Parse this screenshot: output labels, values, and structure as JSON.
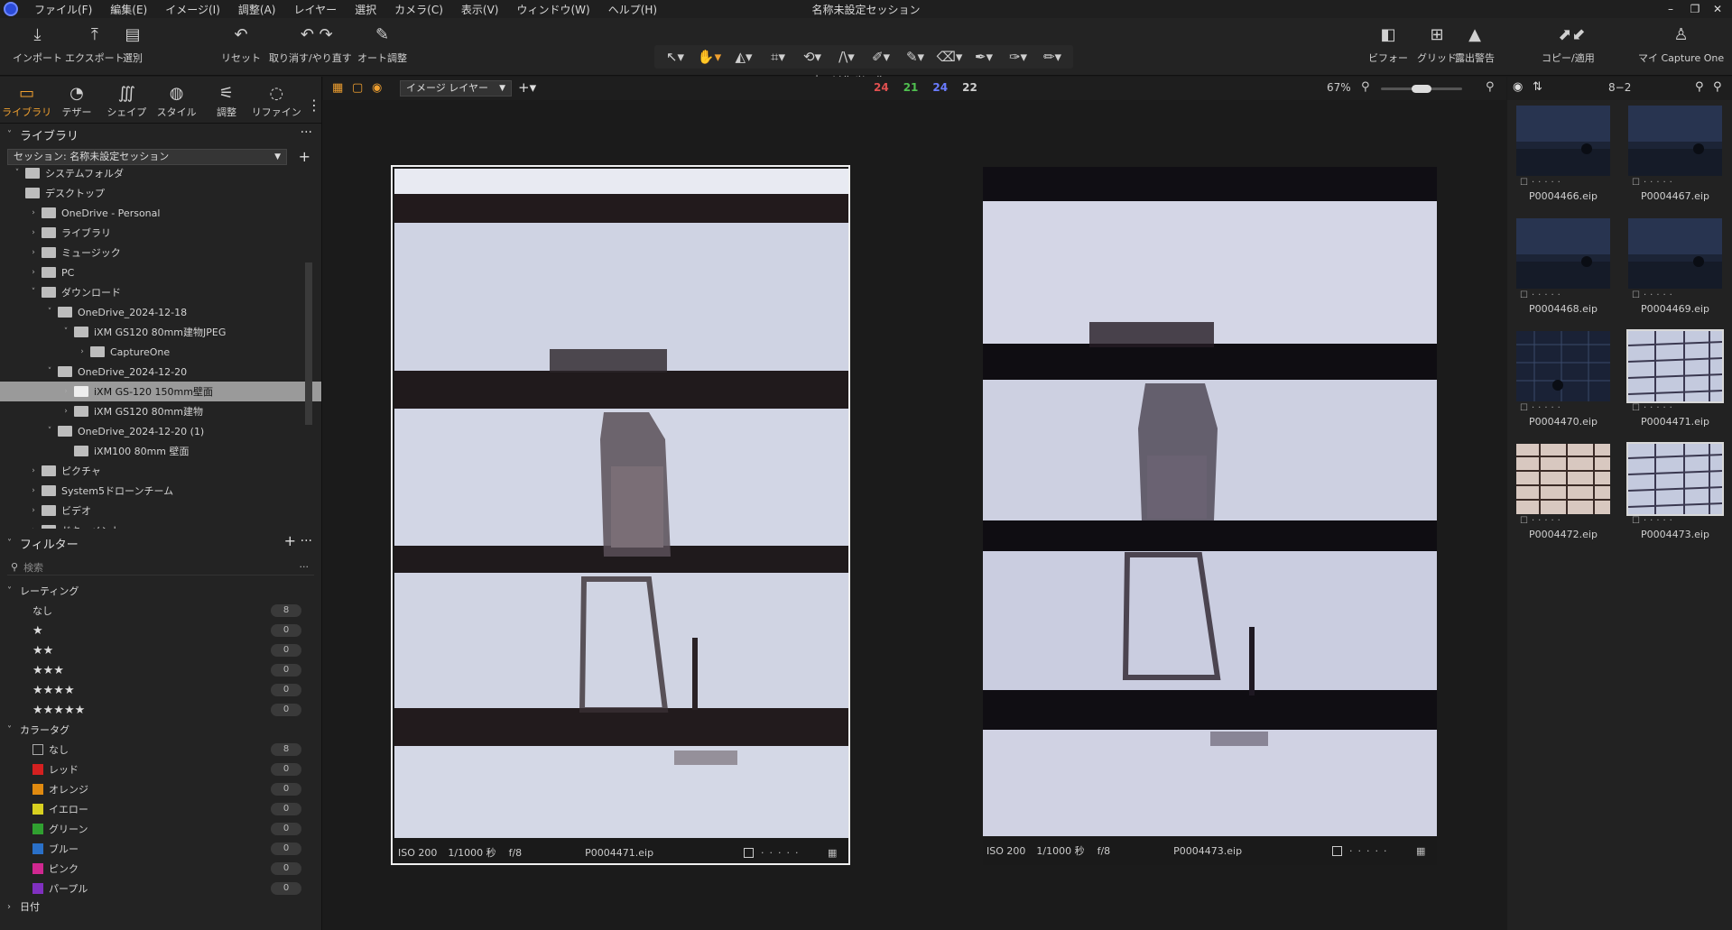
{
  "menu": {
    "items": [
      "ファイル(F)",
      "編集(E)",
      "イメージ(I)",
      "調整(A)",
      "レイヤー",
      "選択",
      "カメラ(C)",
      "表示(V)",
      "ウィンドウ(W)",
      "ヘルプ(H)"
    ],
    "title": "名称未設定セッション"
  },
  "toolbar": {
    "left": [
      {
        "label": "インポート",
        "icon": "import-icon"
      },
      {
        "label": "エクスポート",
        "icon": "export-icon"
      },
      {
        "label": "選別",
        "icon": "cull-icon"
      },
      {
        "label": "リセット",
        "icon": "reset-icon"
      },
      {
        "label": "取り消す/やり直す",
        "icon": "undo-redo-icon"
      },
      {
        "label": "オート調整",
        "icon": "auto-adjust-icon"
      }
    ],
    "cursor_label": "カーソル ツール",
    "right": [
      {
        "label": "ビフォー",
        "icon": "before-icon"
      },
      {
        "label": "グリッド",
        "icon": "grid-icon"
      },
      {
        "label": "露出警告",
        "icon": "exposure-warning-icon"
      },
      {
        "label": "コピー/適用",
        "icon": "copy-apply-icon"
      },
      {
        "label": "マイ Capture One",
        "icon": "user-icon"
      }
    ]
  },
  "tooltabs": [
    {
      "label": "ライブラリ",
      "active": true
    },
    {
      "label": "テザー"
    },
    {
      "label": "シェイプ"
    },
    {
      "label": "スタイル"
    },
    {
      "label": "調整"
    },
    {
      "label": "リファイン"
    }
  ],
  "library": {
    "title": "ライブラリ",
    "session": "セッション: 名称未設定セッション",
    "tree": [
      {
        "label": "システムフォルダ",
        "level": 0,
        "twisty": "˅"
      },
      {
        "label": "デスクトップ",
        "level": 0,
        "twisty": ""
      },
      {
        "label": "OneDrive - Personal",
        "level": 1,
        "twisty": "›"
      },
      {
        "label": "ライブラリ",
        "level": 1,
        "twisty": "›"
      },
      {
        "label": "ミュージック",
        "level": 1,
        "twisty": "›"
      },
      {
        "label": "PC",
        "level": 1,
        "twisty": "›"
      },
      {
        "label": "ダウンロード",
        "level": 1,
        "twisty": "˅"
      },
      {
        "label": "OneDrive_2024-12-18",
        "level": 2,
        "twisty": "˅"
      },
      {
        "label": "iXM GS120 80mm建物JPEG",
        "level": 3,
        "twisty": "˅"
      },
      {
        "label": "CaptureOne",
        "level": 4,
        "twisty": "›"
      },
      {
        "label": "OneDrive_2024-12-20",
        "level": 2,
        "twisty": "˅"
      },
      {
        "label": "iXM GS-120 150mm壁面",
        "level": 3,
        "twisty": "›",
        "selected": true
      },
      {
        "label": "iXM GS120 80mm建物",
        "level": 3,
        "twisty": "›"
      },
      {
        "label": "OneDrive_2024-12-20 (1)",
        "level": 2,
        "twisty": "˅"
      },
      {
        "label": "iXM100 80mm 壁面",
        "level": 3,
        "twisty": ""
      },
      {
        "label": "ピクチャ",
        "level": 1,
        "twisty": "›"
      },
      {
        "label": "System5ドローンチーム",
        "level": 1,
        "twisty": "›"
      },
      {
        "label": "ビデオ",
        "level": 1,
        "twisty": "›"
      },
      {
        "label": "ドキュメント",
        "level": 1,
        "twisty": "›"
      }
    ]
  },
  "filters": {
    "title": "フィルター",
    "search_placeholder": "検索",
    "rating_title": "レーティング",
    "ratings": [
      {
        "label": "なし",
        "count": "8"
      },
      {
        "stars": "★",
        "count": "0"
      },
      {
        "stars": "★★",
        "count": "0"
      },
      {
        "stars": "★★★",
        "count": "0"
      },
      {
        "stars": "★★★★",
        "count": "0"
      },
      {
        "stars": "★★★★★",
        "count": "0"
      }
    ],
    "colortag_title": "カラータグ",
    "colortags": [
      {
        "label": "なし",
        "color": "none",
        "count": "8"
      },
      {
        "label": "レッド",
        "color": "#d42020",
        "count": "0"
      },
      {
        "label": "オレンジ",
        "color": "#e08a10",
        "count": "0"
      },
      {
        "label": "イエロー",
        "color": "#d8d020",
        "count": "0"
      },
      {
        "label": "グリーン",
        "color": "#30a030",
        "count": "0"
      },
      {
        "label": "ブルー",
        "color": "#2a70c8",
        "count": "0"
      },
      {
        "label": "ピンク",
        "color": "#d02890",
        "count": "0"
      },
      {
        "label": "パープル",
        "color": "#8030c0",
        "count": "0"
      }
    ],
    "date_title": "日付"
  },
  "viewer": {
    "layer_select": "イメージ レイヤー",
    "counts": [
      {
        "value": "24",
        "color": "#e05050"
      },
      {
        "value": "21",
        "color": "#50c050"
      },
      {
        "value": "24",
        "color": "#6a7cff"
      },
      {
        "value": "22",
        "color": "#cfcfcf"
      }
    ],
    "zoom": "67%",
    "photos": [
      {
        "iso": "ISO 200",
        "shutter": "1/1000 秒",
        "aperture": "f/8",
        "file": "P0004471.eip"
      },
      {
        "iso": "ISO 200",
        "shutter": "1/1000 秒",
        "aperture": "f/8",
        "file": "P0004473.eip"
      }
    ]
  },
  "browser": {
    "count": "8−2",
    "thumbs": [
      {
        "file": "P0004466.eip",
        "kind": "dark"
      },
      {
        "file": "P0004467.eip",
        "kind": "dark"
      },
      {
        "file": "P0004468.eip",
        "kind": "dark"
      },
      {
        "file": "P0004469.eip",
        "kind": "dark"
      },
      {
        "file": "P0004470.eip",
        "kind": "grid"
      },
      {
        "file": "P0004471.eip",
        "kind": "light",
        "selected": true
      },
      {
        "file": "P0004472.eip",
        "kind": "warm"
      },
      {
        "file": "P0004473.eip",
        "kind": "light",
        "selected": true
      }
    ]
  }
}
